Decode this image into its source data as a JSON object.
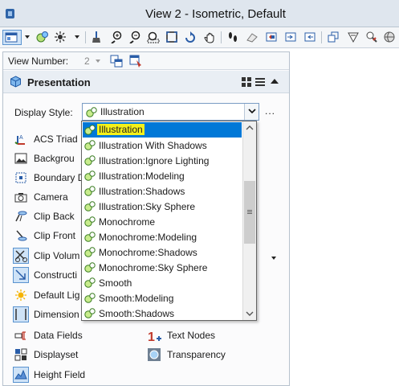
{
  "window": {
    "title": "View 2 - Isometric, Default"
  },
  "toolbar": {
    "icons": [
      "view-display-icon",
      "view-attributes-icon",
      "lights-icon",
      "brush-icon",
      "zoom-in-icon",
      "zoom-out-icon",
      "window-area-icon",
      "fit-view-icon",
      "rotate-view-icon",
      "pan-view-icon",
      "walk-icon",
      "clip-volume-icon",
      "view-previous-icon",
      "view-next-icon",
      "copy-view-icon",
      "perspective-icon",
      "render-icon",
      "camera-icon",
      "sphere-icon"
    ]
  },
  "view_number": {
    "label": "View Number:",
    "value": "2"
  },
  "presentation": {
    "title": "Presentation"
  },
  "display_style": {
    "label": "Display Style:",
    "value": "Illustration",
    "more": "..."
  },
  "panel_items": [
    {
      "label": "ACS Triad",
      "icon": "acs-triad-icon"
    },
    {
      "label": "Backgrou",
      "icon": "background-icon"
    },
    {
      "label": "Boundary D",
      "icon": "boundary-icon"
    },
    {
      "label": "Camera",
      "icon": "camera-icon"
    },
    {
      "label": "Clip Back",
      "icon": "clip-back-icon"
    },
    {
      "label": "Clip Front",
      "icon": "clip-front-icon"
    },
    {
      "label": "Clip Volum",
      "icon": "clip-volume-icon"
    },
    {
      "label": "Constructi",
      "icon": "construction-icon"
    },
    {
      "label": "Default Lig",
      "icon": "default-lighting-icon"
    },
    {
      "label": "Dimension",
      "icon": "dimensions-icon"
    },
    {
      "label": "Data Fields",
      "icon": "data-fields-icon"
    },
    {
      "label": "Displayset",
      "icon": "displayset-icon"
    },
    {
      "label": "Height Field",
      "icon": "height-field-icon"
    }
  ],
  "panel_right_items": [
    {
      "label": "Text Nodes",
      "icon": "text-nodes-icon"
    },
    {
      "label": "Transparency",
      "icon": "transparency-icon"
    }
  ],
  "dropdown_options": [
    "Illustration",
    "Illustration With Shadows",
    "Illustration:Ignore Lighting",
    "Illustration:Modeling",
    "Illustration:Shadows",
    "Illustration:Sky Sphere",
    "Monochrome",
    "Monochrome:Modeling",
    "Monochrome:Shadows",
    "Monochrome:Sky Sphere",
    "Smooth",
    "Smooth:Modeling",
    "Smooth:Shadows"
  ],
  "selected_option": "Illustration",
  "colors": {
    "accent": "#0078d7",
    "highlight": "#f4f11a",
    "selected_border": "#5a93cf"
  }
}
